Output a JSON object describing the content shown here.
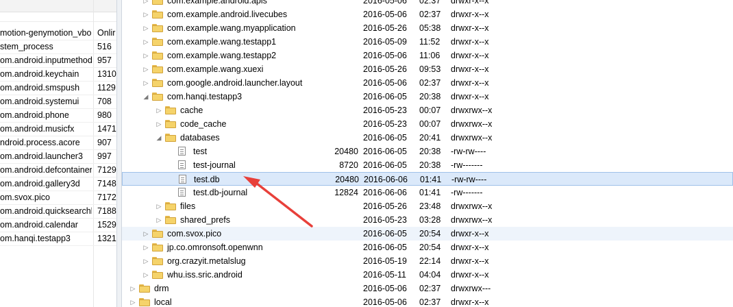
{
  "left_table": {
    "rows": [
      {
        "name": "motion-genymotion_vbo",
        "pid": "Onlir"
      },
      {
        "name": "stem_process",
        "pid": "516"
      },
      {
        "name": "om.android.inputmethod",
        "pid": "957"
      },
      {
        "name": "om.android.keychain",
        "pid": "1310"
      },
      {
        "name": "om.android.smspush",
        "pid": "1129"
      },
      {
        "name": "om.android.systemui",
        "pid": "708"
      },
      {
        "name": "om.android.phone",
        "pid": "980"
      },
      {
        "name": "om.android.musicfx",
        "pid": "1471"
      },
      {
        "name": "ndroid.process.acore",
        "pid": "907"
      },
      {
        "name": "om.android.launcher3",
        "pid": "997"
      },
      {
        "name": "om.android.defcontainer",
        "pid": "7129"
      },
      {
        "name": "om.android.gallery3d",
        "pid": "7148"
      },
      {
        "name": "om.svox.pico",
        "pid": "7172"
      },
      {
        "name": "om.android.quicksearchb",
        "pid": "7188"
      },
      {
        "name": "om.android.calendar",
        "pid": "1529"
      },
      {
        "name": "om.hanqi.testapp3",
        "pid": "1321"
      }
    ]
  },
  "file_tree": {
    "rows": [
      {
        "name": "com.example.android.apis",
        "size": "",
        "date": "2016-05-06",
        "time": "02:37",
        "perm": "drwxr-x--x",
        "type": "folder",
        "level": 2,
        "arrow": "collapsed"
      },
      {
        "name": "com.example.android.livecubes",
        "size": "",
        "date": "2016-05-06",
        "time": "02:37",
        "perm": "drwxr-x--x",
        "type": "folder",
        "level": 2,
        "arrow": "collapsed"
      },
      {
        "name": "com.example.wang.myapplication",
        "size": "",
        "date": "2016-05-26",
        "time": "05:38",
        "perm": "drwxr-x--x",
        "type": "folder",
        "level": 2,
        "arrow": "collapsed"
      },
      {
        "name": "com.example.wang.testapp1",
        "size": "",
        "date": "2016-05-09",
        "time": "11:52",
        "perm": "drwxr-x--x",
        "type": "folder",
        "level": 2,
        "arrow": "collapsed"
      },
      {
        "name": "com.example.wang.testapp2",
        "size": "",
        "date": "2016-05-06",
        "time": "11:06",
        "perm": "drwxr-x--x",
        "type": "folder",
        "level": 2,
        "arrow": "collapsed"
      },
      {
        "name": "com.example.wang.xuexi",
        "size": "",
        "date": "2016-05-26",
        "time": "09:53",
        "perm": "drwxr-x--x",
        "type": "folder",
        "level": 2,
        "arrow": "collapsed"
      },
      {
        "name": "com.google.android.launcher.layout",
        "size": "",
        "date": "2016-05-06",
        "time": "02:37",
        "perm": "drwxr-x--x",
        "type": "folder",
        "level": 2,
        "arrow": "collapsed"
      },
      {
        "name": "com.hanqi.testapp3",
        "size": "",
        "date": "2016-06-05",
        "time": "20:38",
        "perm": "drwxr-x--x",
        "type": "folder",
        "level": 2,
        "arrow": "expanded"
      },
      {
        "name": "cache",
        "size": "",
        "date": "2016-05-23",
        "time": "00:07",
        "perm": "drwxrwx--x",
        "type": "folder",
        "level": 3,
        "arrow": "collapsed"
      },
      {
        "name": "code_cache",
        "size": "",
        "date": "2016-05-23",
        "time": "00:07",
        "perm": "drwxrwx--x",
        "type": "folder",
        "level": 3,
        "arrow": "collapsed"
      },
      {
        "name": "databases",
        "size": "",
        "date": "2016-06-05",
        "time": "20:41",
        "perm": "drwxrwx--x",
        "type": "folder",
        "level": 3,
        "arrow": "expanded"
      },
      {
        "name": "test",
        "size": "20480",
        "date": "2016-06-05",
        "time": "20:38",
        "perm": "-rw-rw----",
        "type": "file",
        "level": 4,
        "arrow": "none"
      },
      {
        "name": "test-journal",
        "size": "8720",
        "date": "2016-06-05",
        "time": "20:38",
        "perm": "-rw-------",
        "type": "file",
        "level": 4,
        "arrow": "none"
      },
      {
        "name": "test.db",
        "size": "20480",
        "date": "2016-06-06",
        "time": "01:41",
        "perm": "-rw-rw----",
        "type": "file",
        "level": 4,
        "arrow": "none",
        "selected": true
      },
      {
        "name": "test.db-journal",
        "size": "12824",
        "date": "2016-06-06",
        "time": "01:41",
        "perm": "-rw-------",
        "type": "file",
        "level": 4,
        "arrow": "none"
      },
      {
        "name": "files",
        "size": "",
        "date": "2016-05-26",
        "time": "23:48",
        "perm": "drwxrwx--x",
        "type": "folder",
        "level": 3,
        "arrow": "collapsed"
      },
      {
        "name": "shared_prefs",
        "size": "",
        "date": "2016-05-23",
        "time": "03:28",
        "perm": "drwxrwx--x",
        "type": "folder",
        "level": 3,
        "arrow": "collapsed"
      },
      {
        "name": "com.svox.pico",
        "size": "",
        "date": "2016-06-05",
        "time": "20:54",
        "perm": "drwxr-x--x",
        "type": "folder",
        "level": 2,
        "arrow": "collapsed",
        "hovered": true
      },
      {
        "name": "jp.co.omronsoft.openwnn",
        "size": "",
        "date": "2016-06-05",
        "time": "20:54",
        "perm": "drwxr-x--x",
        "type": "folder",
        "level": 2,
        "arrow": "collapsed"
      },
      {
        "name": "org.crazyit.metalslug",
        "size": "",
        "date": "2016-05-19",
        "time": "22:14",
        "perm": "drwxr-x--x",
        "type": "folder",
        "level": 2,
        "arrow": "collapsed"
      },
      {
        "name": "whu.iss.sric.android",
        "size": "",
        "date": "2016-05-11",
        "time": "04:04",
        "perm": "drwxr-x--x",
        "type": "folder",
        "level": 2,
        "arrow": "collapsed"
      },
      {
        "name": "drm",
        "size": "",
        "date": "2016-05-06",
        "time": "02:37",
        "perm": "drwxrwx---",
        "type": "folder",
        "level": 1,
        "arrow": "collapsed"
      },
      {
        "name": "local",
        "size": "",
        "date": "2016-05-06",
        "time": "02:37",
        "perm": "drwxr-x--x",
        "type": "folder",
        "level": 1,
        "arrow": "collapsed"
      }
    ]
  },
  "annotation": {
    "color": "#e8403a"
  },
  "colors": {
    "selected_bg": "#dbe9fa",
    "selected_border": "#9fc1e8",
    "folder": "#f5d36a"
  }
}
